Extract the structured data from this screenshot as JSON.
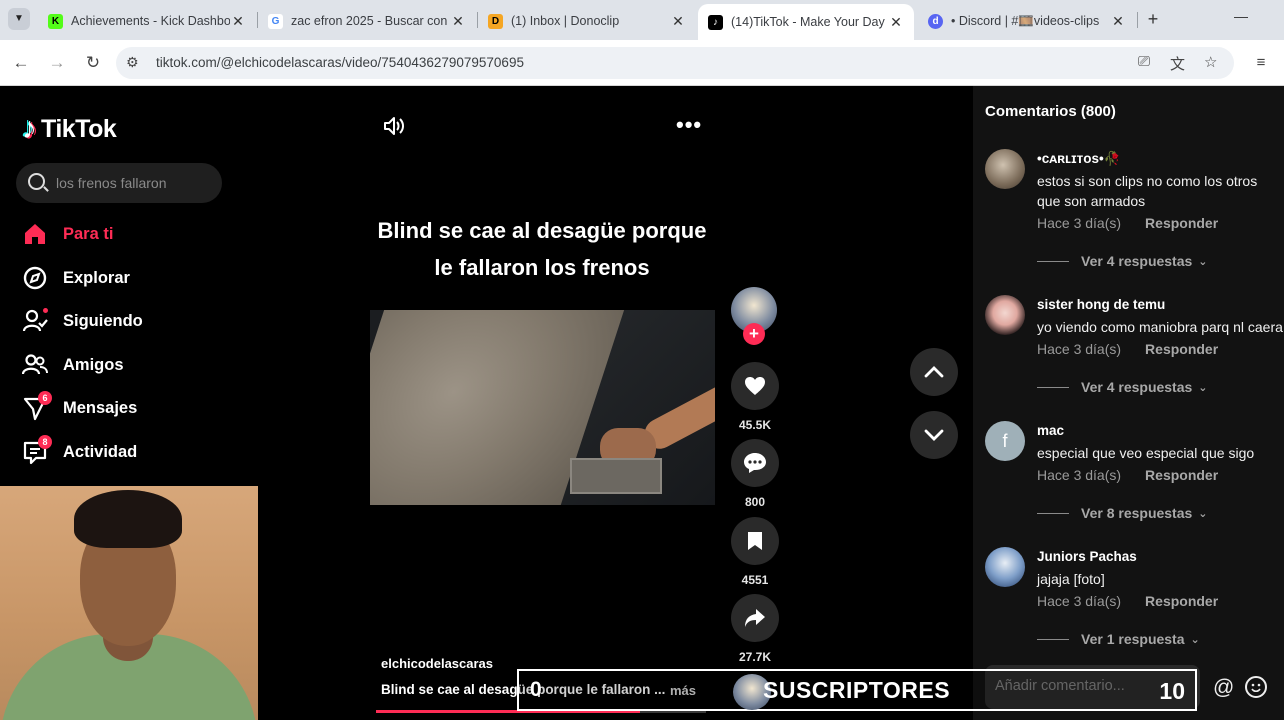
{
  "browser": {
    "tabs": [
      {
        "title": "Achievements - Kick Dashboard",
        "favicon": "kick-icon"
      },
      {
        "title": "zac efron 2025 - Buscar con Google",
        "favicon": "google-icon"
      },
      {
        "title": "(1) Inbox | Donoclip",
        "favicon": "donoclip-icon"
      },
      {
        "title": "(14)TikTok - Make Your Day",
        "favicon": "tiktok-icon",
        "active": true
      },
      {
        "title": "• Discord | #🎞️videos-clips",
        "favicon": "discord-icon"
      }
    ],
    "url": "tiktok.com/@elchicodelascaras/video/7540436279079570695"
  },
  "sidebar": {
    "logo": "TikTok",
    "search_placeholder": "los frenos fallaron",
    "items": [
      {
        "label": "Para ti",
        "icon": "home-icon",
        "active": true
      },
      {
        "label": "Explorar",
        "icon": "compass-icon"
      },
      {
        "label": "Siguiendo",
        "icon": "following-icon"
      },
      {
        "label": "Amigos",
        "icon": "friends-icon"
      },
      {
        "label": "Mensajes",
        "icon": "messages-icon",
        "badge": "6"
      },
      {
        "label": "Actividad",
        "icon": "activity-icon",
        "badge": "8"
      }
    ]
  },
  "video": {
    "title_line1": "Blind se cae al desagüe porque",
    "title_line2": "le fallaron los frenos",
    "username": "elchicodelascaras",
    "description": "Blind se cae al desagüe porque le fallaron ...",
    "more_label": "más",
    "likes": "45.5K",
    "comments": "800",
    "saves": "4551",
    "shares": "27.7K",
    "progress": 0.8
  },
  "comments_panel": {
    "header": "Comentarios (800)",
    "input_placeholder": "Añadir comentario...",
    "items": [
      {
        "name": "•ᴄᴀʀʟɪᴛᴏs•🥀",
        "text": "estos si son clips no como los otros que son armados",
        "time": "Hace 3 día(s)",
        "reply": "Responder",
        "more": "Ver 4 respuestas"
      },
      {
        "name": "sister hong de temu",
        "text": "yo viendo como maniobra parq nl caera",
        "time": "Hace 3 día(s)",
        "reply": "Responder",
        "more": "Ver 4 respuestas"
      },
      {
        "name": "mac",
        "text": "especial que veo especial que sigo",
        "time": "Hace 3 día(s)",
        "reply": "Responder",
        "more": "Ver 8 respuestas",
        "avatar_letter": "f"
      },
      {
        "name": "Juniors Pachas",
        "text": "jajaja [foto]",
        "time": "Hace 3 día(s)",
        "reply": "Responder",
        "more": "Ver 1 respuesta"
      }
    ]
  },
  "overlay": {
    "left_count": "0",
    "title": "SUSCRIPTORES",
    "right_count": "10"
  },
  "colors": {
    "accent": "#fe2c55",
    "panel": "#121212",
    "chrome": "#dfe3e9"
  }
}
